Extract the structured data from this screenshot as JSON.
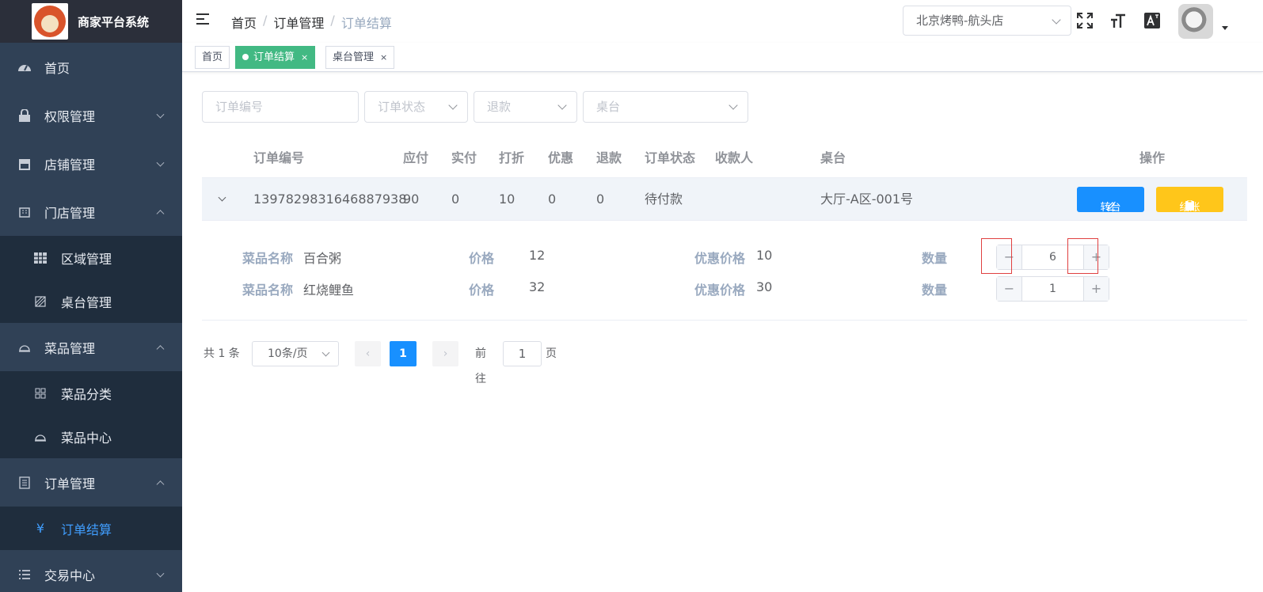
{
  "app": {
    "title": "商家平台系统"
  },
  "sidebar": {
    "items": [
      {
        "label": "首页",
        "icon": "dashboard-icon"
      },
      {
        "label": "权限管理",
        "icon": "lock-icon"
      },
      {
        "label": "店铺管理",
        "icon": "store-icon"
      },
      {
        "label": "门店管理",
        "icon": "building-icon"
      },
      {
        "label": "区域管理",
        "icon": "grid-icon"
      },
      {
        "label": "桌台管理",
        "icon": "table-icon"
      },
      {
        "label": "菜品管理",
        "icon": "dish-cover-icon"
      },
      {
        "label": "菜品分类",
        "icon": "category-icon"
      },
      {
        "label": "菜品中心",
        "icon": "dish-cover-icon"
      },
      {
        "label": "订单管理",
        "icon": "document-icon"
      },
      {
        "label": "订单结算",
        "icon": "yuan-icon"
      },
      {
        "label": "交易中心",
        "icon": "list-icon"
      }
    ]
  },
  "header": {
    "breadcrumb": [
      "首页",
      "/",
      "订单管理",
      "/",
      "订单结算"
    ],
    "store": "北京烤鸭-航头店"
  },
  "tags": [
    "首页",
    "订单结算",
    "桌台管理"
  ],
  "filters": {
    "order_no": "订单编号",
    "status": "订单状态",
    "refund": "退款",
    "table": "桌台"
  },
  "table": {
    "headers": [
      "订单编号",
      "应付",
      "实付",
      "打折",
      "优惠",
      "退款",
      "订单状态",
      "收款人",
      "桌台",
      "操作"
    ],
    "row": {
      "order_no": "1397829831646887938",
      "payable": "90",
      "paid": "0",
      "discount": "10",
      "promo": "0",
      "refund": "0",
      "status": "待付款",
      "cashier": "",
      "table": "大厅-A区-001号"
    },
    "actions": {
      "transfer": "转台",
      "checkout": "结账"
    }
  },
  "detail": {
    "labels": {
      "name": "菜品名称",
      "price": "价格",
      "promo_price": "优惠价格",
      "qty": "数量"
    },
    "items": [
      {
        "name": "百合粥",
        "price": "12",
        "promo_price": "10",
        "qty": "6"
      },
      {
        "name": "红烧鲤鱼",
        "price": "32",
        "promo_price": "30",
        "qty": "1"
      }
    ]
  },
  "pagination": {
    "total": "共 1 条",
    "page_size": "10条/页",
    "current": "1",
    "goto_label": "前往",
    "goto_value": "1",
    "page_unit": "页"
  },
  "colors": {
    "primary": "#1890ff",
    "warning": "#ffc61a",
    "tag_active": "#42b983",
    "sidebar": "#304156"
  }
}
